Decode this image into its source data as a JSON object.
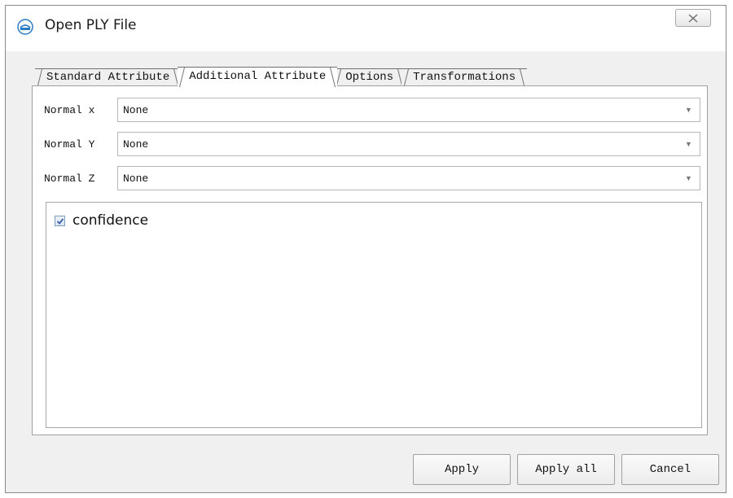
{
  "window": {
    "title": "Open PLY File",
    "app_icon": "app-logo-icon",
    "close_icon": "close-icon"
  },
  "tabs": [
    {
      "label": "Standard Attribute",
      "active": false
    },
    {
      "label": "Additional Attribute",
      "active": true
    },
    {
      "label": "Options",
      "active": false
    },
    {
      "label": "Transformations",
      "active": false
    }
  ],
  "fields": [
    {
      "label": "Normal x",
      "value": "None"
    },
    {
      "label": "Normal Y",
      "value": "None"
    },
    {
      "label": "Normal Z",
      "value": "None"
    }
  ],
  "attributes_list": [
    {
      "label": "confidence",
      "checked": true
    }
  ],
  "buttons": {
    "apply": "Apply",
    "apply_all": "Apply all",
    "cancel": "Cancel"
  },
  "colors": {
    "checkmark": "#3a5fa8",
    "logo": "#2a7bc6"
  }
}
